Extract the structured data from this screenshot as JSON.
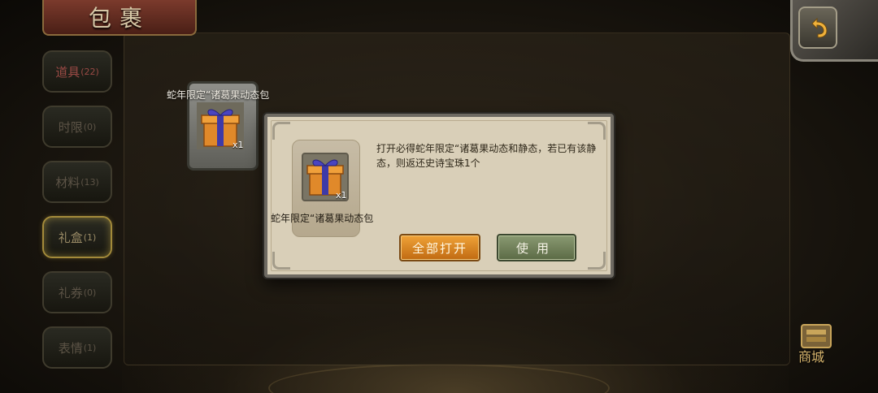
{
  "header": {
    "title": "包裹"
  },
  "tabs": [
    {
      "label": "道具",
      "count": "(22)"
    },
    {
      "label": "时限",
      "count": "(0)"
    },
    {
      "label": "材料",
      "count": "(13)"
    },
    {
      "label": "礼盒",
      "count": "(1)"
    },
    {
      "label": "礼券",
      "count": "(0)"
    },
    {
      "label": "表情",
      "count": "(1)"
    }
  ],
  "inventory": {
    "item": {
      "name": "蛇年限定“诸葛果动态包",
      "quantity": "x1",
      "icon": "gift-box-icon"
    }
  },
  "dialog": {
    "item_name": "蛇年限定“诸葛果动态包",
    "quantity": "x1",
    "description": "打开必得蛇年限定“诸葛果动态和静态，若已有该静态，则返还史诗宝珠1个",
    "open_all_label": "全部打开",
    "use_label": "使用"
  },
  "shop": {
    "label": "商城"
  },
  "colors": {
    "accent_orange": "#e08a22",
    "accent_green": "#6f7f55",
    "title_red": "#6a2d22"
  }
}
